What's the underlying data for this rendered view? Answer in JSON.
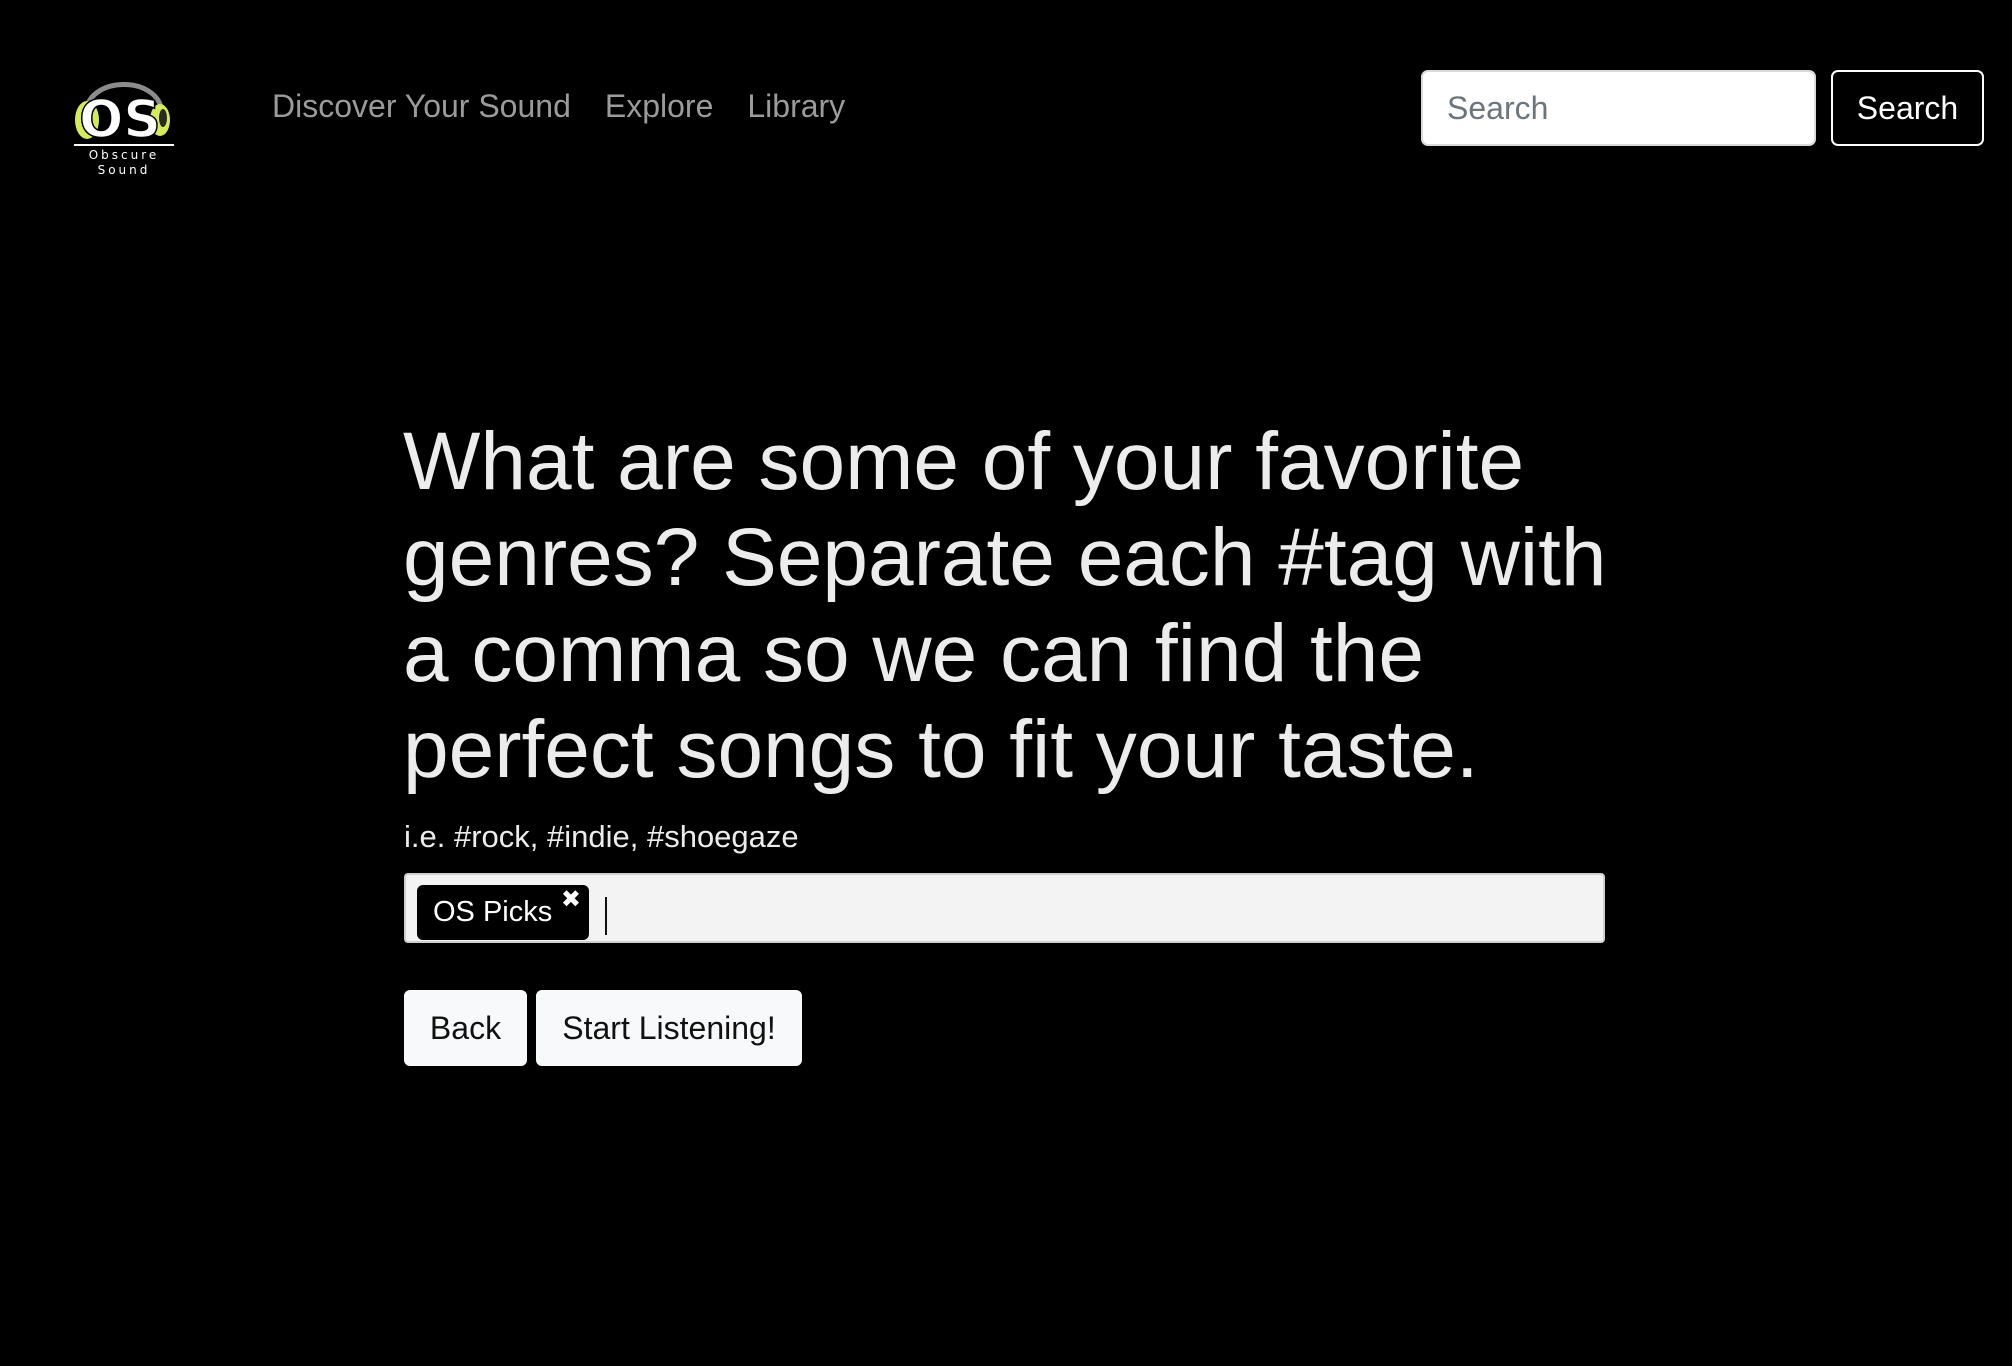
{
  "brand": {
    "logo_letters": "OS",
    "name_line1": "Obscure",
    "name_line2": "Sound",
    "colors": {
      "accent_green": "#d4ec5a",
      "headphone_gray": "#8c8c8c"
    }
  },
  "nav": {
    "links": [
      {
        "label": "Discover Your Sound"
      },
      {
        "label": "Explore"
      },
      {
        "label": "Library"
      }
    ],
    "search": {
      "placeholder": "Search",
      "value": "",
      "button_label": "Search"
    }
  },
  "main": {
    "heading": "What are some of your favorite genres? Separate each #tag with a comma so we can find the perfect songs to fit your taste.",
    "hint": "i.e. #rock, #indie, #shoegaze",
    "tags": [
      {
        "label": "OS Picks",
        "remove_icon": "close-icon"
      }
    ],
    "tag_input_value": "",
    "buttons": {
      "back_label": "Back",
      "start_label": "Start Listening!"
    }
  },
  "colors": {
    "background": "#000000",
    "text_primary": "#ececec",
    "nav_text": "#9b9b9b",
    "button_light": "#f8f9fa"
  }
}
